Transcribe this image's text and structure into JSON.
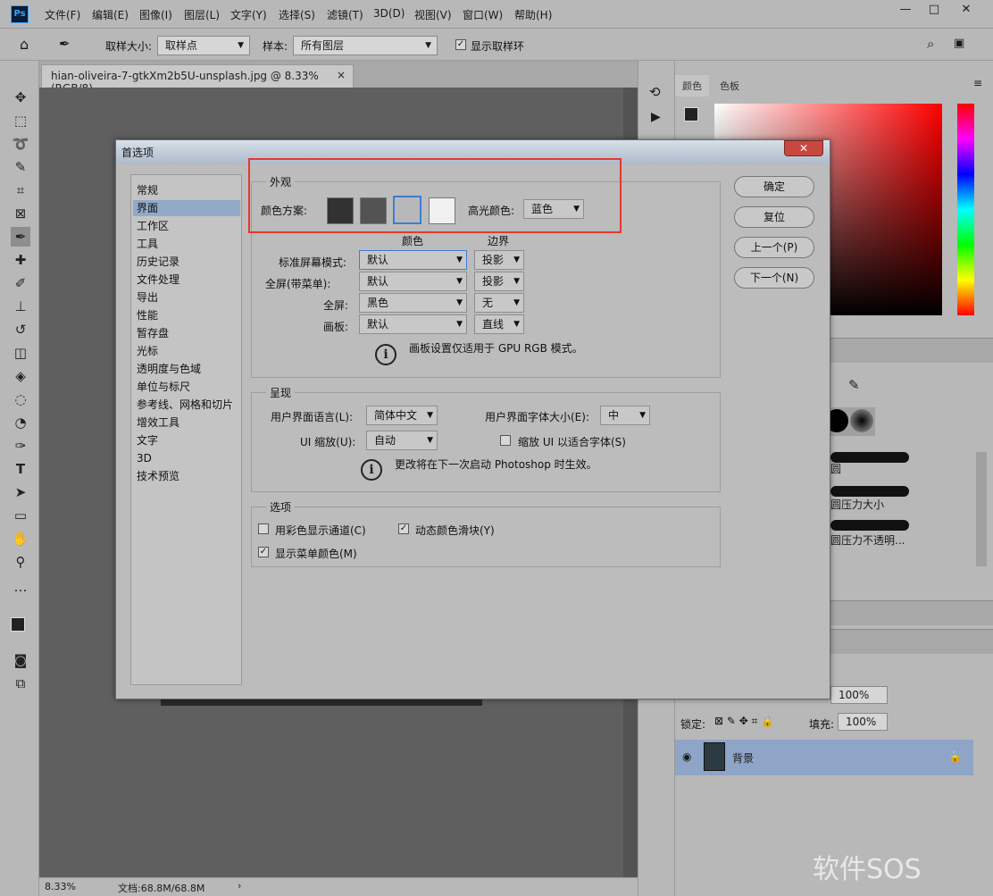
{
  "app": {
    "logo_text": "Ps"
  },
  "menubar": {
    "items": [
      "文件(F)",
      "编辑(E)",
      "图像(I)",
      "图层(L)",
      "文字(Y)",
      "选择(S)",
      "滤镜(T)",
      "3D(D)",
      "视图(V)",
      "窗口(W)",
      "帮助(H)"
    ]
  },
  "window_controls": {
    "minimize": "—",
    "maximize": "□",
    "close": "✕"
  },
  "optbar": {
    "sample_size_label": "取样大小:",
    "sample_size_value": "取样点",
    "sample_label": "样本:",
    "sample_value": "所有图层",
    "show_ring_label": "显示取样环",
    "show_ring_checked": true
  },
  "document": {
    "tab_title": "hian-oliveira-7-gtkXm2b5U-unsplash.jpg @ 8.33%(RGB/8)",
    "tab_close": "×",
    "zoom": "8.33%",
    "doc_size": "文档:68.8M/68.8M"
  },
  "panels": {
    "color_tabs": [
      "颜色",
      "色板"
    ],
    "brushes": [
      "圆",
      "圆压力大小",
      "圆压力不透明..."
    ],
    "opacity_value": "100%",
    "fill_label": "填充:",
    "fill_value": "100%",
    "lock_label": "锁定:",
    "layer_name": "背景"
  },
  "dialog": {
    "title": "首选项",
    "close": "✕",
    "nav": [
      "常规",
      "界面",
      "工作区",
      "工具",
      "历史记录",
      "文件处理",
      "导出",
      "性能",
      "暂存盘",
      "光标",
      "透明度与色域",
      "单位与标尺",
      "参考线、网格和切片",
      "增效工具",
      "文字",
      "3D",
      "技术预览"
    ],
    "nav_selected": 1,
    "appearance": {
      "title": "外观",
      "color_scheme_label": "颜色方案:",
      "scheme_colors": [
        "#323232",
        "#535353",
        "#b8b8b8",
        "#f0f0f0"
      ],
      "scheme_selected": 2,
      "highlight_label": "高光颜色:",
      "highlight_value": "蓝色",
      "col_color": "颜色",
      "col_border": "边界",
      "rows": [
        {
          "label": "标准屏幕模式:",
          "color": "默认",
          "border": "投影"
        },
        {
          "label": "全屏(带菜单):",
          "color": "默认",
          "border": "投影"
        },
        {
          "label": "全屏:",
          "color": "黑色",
          "border": "无"
        },
        {
          "label": "画板:",
          "color": "默认",
          "border": "直线"
        }
      ],
      "note": "画板设置仅适用于 GPU RGB 模式。"
    },
    "presentation": {
      "title": "呈现",
      "ui_lang_label": "用户界面语言(L):",
      "ui_lang_value": "简体中文",
      "ui_font_label": "用户界面字体大小(E):",
      "ui_font_value": "中",
      "ui_scale_label": "UI 缩放(U):",
      "ui_scale_value": "自动",
      "scale_fit_label": "缩放 UI 以适合字体(S)",
      "scale_fit_checked": false,
      "note": "更改将在下一次启动 Photoshop 时生效。"
    },
    "options": {
      "title": "选项",
      "color_channels_label": "用彩色显示通道(C)",
      "color_channels_checked": false,
      "dynamic_sliders_label": "动态颜色滑块(Y)",
      "dynamic_sliders_checked": true,
      "menu_colors_label": "显示菜单颜色(M)",
      "menu_colors_checked": true
    },
    "buttons": {
      "ok": "确定",
      "reset": "复位",
      "prev": "上一个(P)",
      "next": "下一个(N)"
    }
  },
  "watermark": "软件SOS"
}
